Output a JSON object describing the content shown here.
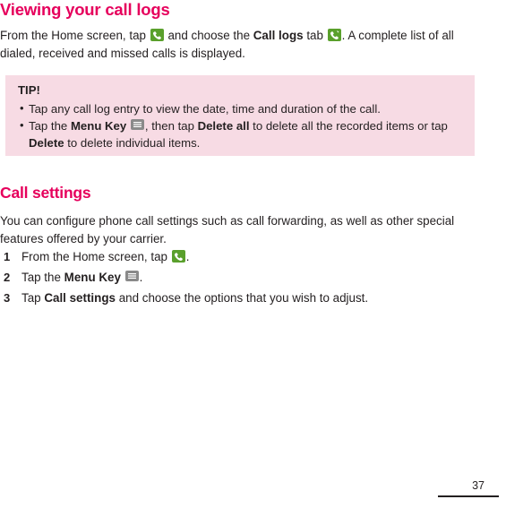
{
  "document": {
    "heading1": "Viewing your call logs",
    "intro": {
      "part1": "From the Home screen, tap",
      "part2": "and choose the",
      "bold1": "Call logs",
      "part3": "tab",
      "part4": ". A complete list of all dialed, received and missed calls is displayed."
    },
    "tip": {
      "title": "TIP!",
      "items": [
        {
          "text1": "Tap any call log entry to view the date, time and duration of the call.",
          "bold1": "",
          "text2": "",
          "bold2": "",
          "text3": "",
          "bold3": "",
          "text4": ""
        },
        {
          "text1": "Tap the",
          "bold1": "Menu Key",
          "text2": ", then tap",
          "bold2": "Delete all",
          "text3": "to delete all the recorded items or tap",
          "bold3": "Delete",
          "text4": "to delete individual items."
        }
      ]
    },
    "heading2": "Call settings",
    "settings_intro": "You can configure phone call settings such as call forwarding, as well as other special features offered by your carrier.",
    "steps": [
      {
        "num": "1",
        "text1": "From the Home screen, tap",
        "bold1": "",
        "text2": ".",
        "icon": "phone-handset-icon"
      },
      {
        "num": "2",
        "text1": "Tap the",
        "bold1": "Menu Key",
        "text2": ".",
        "icon": "menu-key-icon"
      },
      {
        "num": "3",
        "text1": "Tap",
        "bold1": "Call settings",
        "text2": "and choose the options that you wish to adjust.",
        "icon": ""
      }
    ],
    "page_number": "37",
    "colors": {
      "heading": "#e6005c",
      "tip_background": "#f7dbe4",
      "body_text": "#231f20",
      "icon_green": "#5aa02c"
    }
  }
}
